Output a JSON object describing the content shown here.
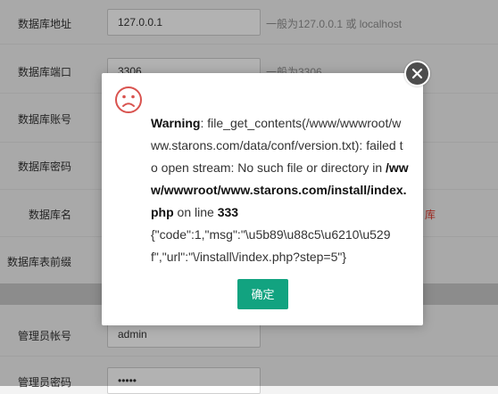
{
  "form": {
    "rows": [
      {
        "label": "数据库地址",
        "value": "127.0.0.1",
        "hint": "一般为127.0.0.1 或 localhost"
      },
      {
        "label": "数据库端口",
        "value": "3306",
        "hint": "一般为3306"
      },
      {
        "label": "数据库账号",
        "value": "",
        "hint": ""
      },
      {
        "label": "数据库密码",
        "value": "",
        "hint": ""
      },
      {
        "label": "数据库名",
        "value": "",
        "hint": "库"
      },
      {
        "label": "数据库表前缀",
        "value": "",
        "hint": ""
      }
    ],
    "admin_rows": [
      {
        "label": "管理员帐号",
        "value": "admin"
      },
      {
        "label": "管理员密码",
        "value": "•••••"
      }
    ]
  },
  "dialog": {
    "icon": "sad-face-icon",
    "warning_label": "Warning",
    "message_1": ": file_get_contents(/www/wwwroot/www.starons.com/data/conf/version.txt): failed to open stream: No such file or directory in ",
    "file_path": "/www/wwwroot/www.starons.com/install/index.php",
    "on_line_text": " on line ",
    "line_number": "333",
    "json_response": "{\"code\":1,\"msg\":\"\\u5b89\\u88c5\\u6210\\u529f\",\"url\":\"\\/install\\/index.php?step=5\"}",
    "ok_label": "确定"
  },
  "colors": {
    "ok_button": "#12a380",
    "hint_red": "#e23b2e",
    "icon_red": "#d9534f",
    "close_button": "#4d4d4d"
  }
}
